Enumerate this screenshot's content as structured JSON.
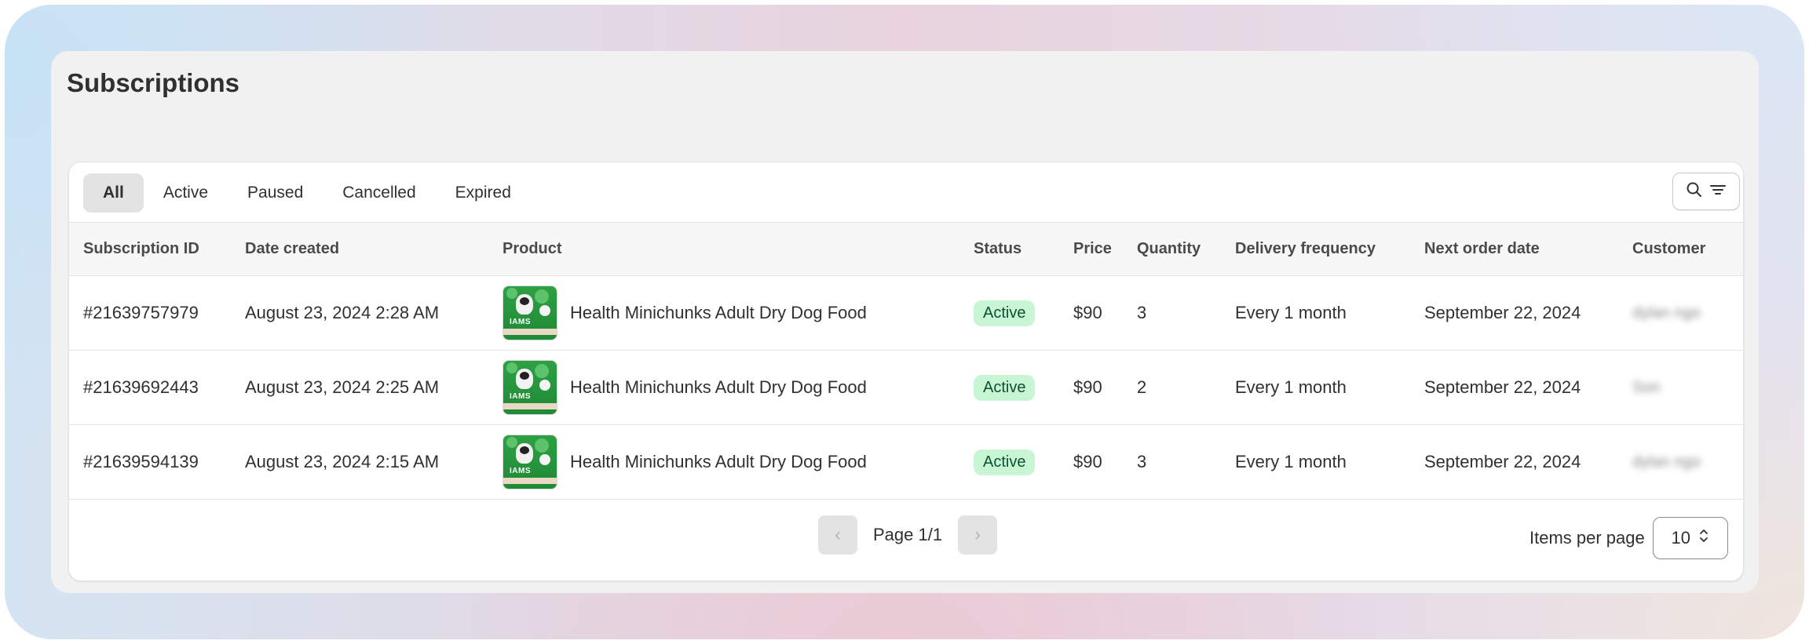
{
  "page": {
    "title": "Subscriptions"
  },
  "tabs": [
    {
      "label": "All",
      "selected": true
    },
    {
      "label": "Active",
      "selected": false
    },
    {
      "label": "Paused",
      "selected": false
    },
    {
      "label": "Cancelled",
      "selected": false
    },
    {
      "label": "Expired",
      "selected": false
    }
  ],
  "toolbar": {
    "icons": [
      "search-icon",
      "filter-icon",
      "sort-icon"
    ]
  },
  "table": {
    "columns": [
      "Subscription ID",
      "Date created",
      "Product",
      "Status",
      "Price",
      "Quantity",
      "Delivery frequency",
      "Next order date",
      "Customer"
    ],
    "rows": [
      {
        "id": "#21639757979",
        "date": "August 23, 2024 2:28 AM",
        "product": "Health Minichunks Adult Dry Dog Food",
        "status": "Active",
        "price": "$90",
        "quantity": "3",
        "frequency": "Every 1 month",
        "next_order": "September 22, 2024",
        "customer": "dylan ngo"
      },
      {
        "id": "#21639692443",
        "date": "August 23, 2024 2:25 AM",
        "product": "Health Minichunks Adult Dry Dog Food",
        "status": "Active",
        "price": "$90",
        "quantity": "2",
        "frequency": "Every 1 month",
        "next_order": "September 22, 2024",
        "customer": "Son"
      },
      {
        "id": "#21639594139",
        "date": "August 23, 2024 2:15 AM",
        "product": "Health Minichunks Adult Dry Dog Food",
        "status": "Active",
        "price": "$90",
        "quantity": "3",
        "frequency": "Every 1 month",
        "next_order": "September 22, 2024",
        "customer": "dylan ngo"
      }
    ]
  },
  "product_thumb": {
    "brand": "IAMS"
  },
  "pagination": {
    "label": "Page 1/1",
    "prev_glyph": "‹",
    "next_glyph": "›"
  },
  "items_per_page": {
    "label": "Items per page",
    "value": "10"
  },
  "colors": {
    "active_badge_bg": "#c8f5d4",
    "active_badge_text": "#0c5132",
    "thumb_green": "#2ea043"
  }
}
